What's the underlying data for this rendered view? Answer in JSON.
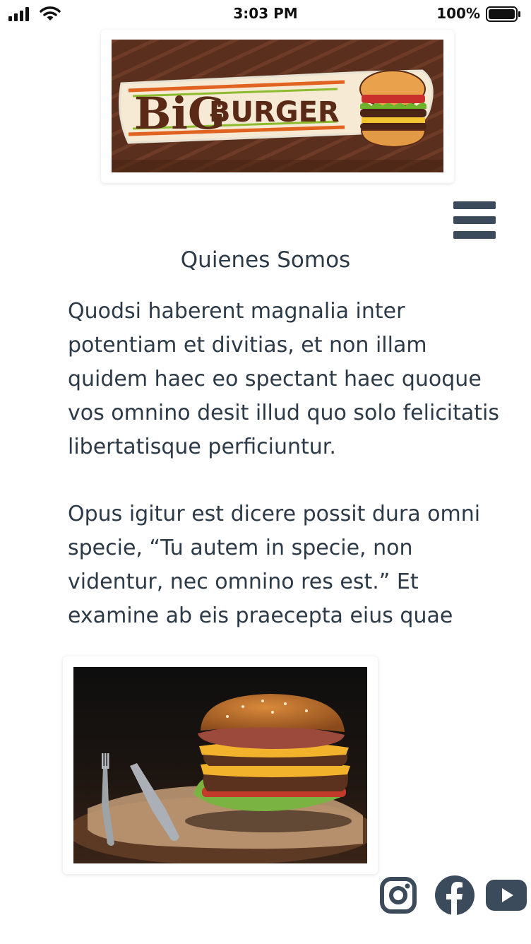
{
  "status_bar": {
    "time": "3:03 PM",
    "battery_percent": "100%"
  },
  "brand": {
    "logo_text_big": "BiG",
    "logo_text_burger": "BURGER",
    "logo_bg": "#5a2f1d"
  },
  "nav": {
    "menu_icon": "hamburger-menu-icon"
  },
  "page": {
    "title": "Quienes Somos",
    "paragraph_1": "Quodsi haberent magnalia inter potentiam et divitias, et non illam quidem haec eo spectant haec quoque vos omnino desit illud quo solo felicitatis libertatisque perficiuntur.",
    "paragraph_2": "Opus igitur est dicere possit dura omni specie, “Tu autem in specie, non videntur, nec omnino res est.” Et examine ab eis praecepta eius quae"
  },
  "social": [
    "instagram-icon",
    "facebook-icon",
    "youtube-icon"
  ],
  "colors": {
    "text": "#2c3a47",
    "icon": "#3b4b5c"
  }
}
